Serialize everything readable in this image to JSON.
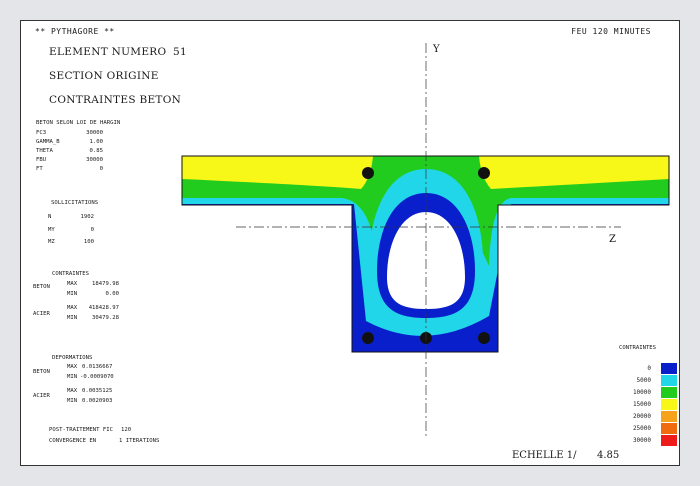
{
  "header": {
    "app_title": "** PYTHAGORE **",
    "fire_duration": "FEU 120 MINUTES"
  },
  "element": {
    "label": "ELEMENT NUMERO",
    "number": "51",
    "section": "SECTION ORIGINE",
    "title": "CONTRAINTES BETON"
  },
  "beton": {
    "heading": "BETON SELON LOI DE HARGIN",
    "params": [
      {
        "name": "FC3",
        "value": "30000"
      },
      {
        "name": "GAMMA_B",
        "value": "1.00"
      },
      {
        "name": "THETA",
        "value": "0.85"
      },
      {
        "name": "FBU",
        "value": "30000"
      },
      {
        "name": "FT",
        "value": "0"
      }
    ]
  },
  "sollicitations": {
    "heading": "SOLLICITATIONS",
    "rows": [
      {
        "name": "N",
        "value": "1902"
      },
      {
        "name": "MY",
        "value": "0"
      },
      {
        "name": "MZ",
        "value": "100"
      }
    ]
  },
  "contraintes": {
    "heading": "CONTRAINTES",
    "beton_label": "BETON",
    "beton_max_label": "MAX",
    "beton_max": "18479.98",
    "beton_min_label": "MIN",
    "beton_min": "0.00",
    "acier_label": "ACIER",
    "acier_max_label": "MAX",
    "acier_max": "418428.97",
    "acier_min_label": "MIN",
    "acier_min": "30479.28"
  },
  "deformations": {
    "heading": "DEFORMATIONS",
    "beton_label": "BETON",
    "beton_max_label": "MAX",
    "beton_max": "0.0136667",
    "beton_min_label": "MIN",
    "beton_min": "-0.0009070",
    "acier_label": "ACIER",
    "acier_max_label": "MAX",
    "acier_max": "0.0035125",
    "acier_min_label": "MIN",
    "acier_min": "0.0020903"
  },
  "post": {
    "line1_label": "POST-TRAITEMENT FIC",
    "line1_value": "120",
    "line2_label": "CONVERGENCE EN",
    "line2_value": "1 ITERATIONS"
  },
  "axes": {
    "y_label": "Y",
    "z_label": "Z"
  },
  "legend": {
    "title": "CONTRAINTES",
    "levels": [
      {
        "value": "0",
        "color": "#0a1fcc"
      },
      {
        "value": "5000",
        "color": "#22d6ea"
      },
      {
        "value": "10000",
        "color": "#22cc1f"
      },
      {
        "value": "15000",
        "color": "#f7f718"
      },
      {
        "value": "20000",
        "color": "#f7a21c"
      },
      {
        "value": "25000",
        "color": "#f06a10"
      },
      {
        "value": "30000",
        "color": "#ee1b1b"
      }
    ]
  },
  "scale": {
    "label": "ECHELLE 1/",
    "value": "4.85"
  }
}
